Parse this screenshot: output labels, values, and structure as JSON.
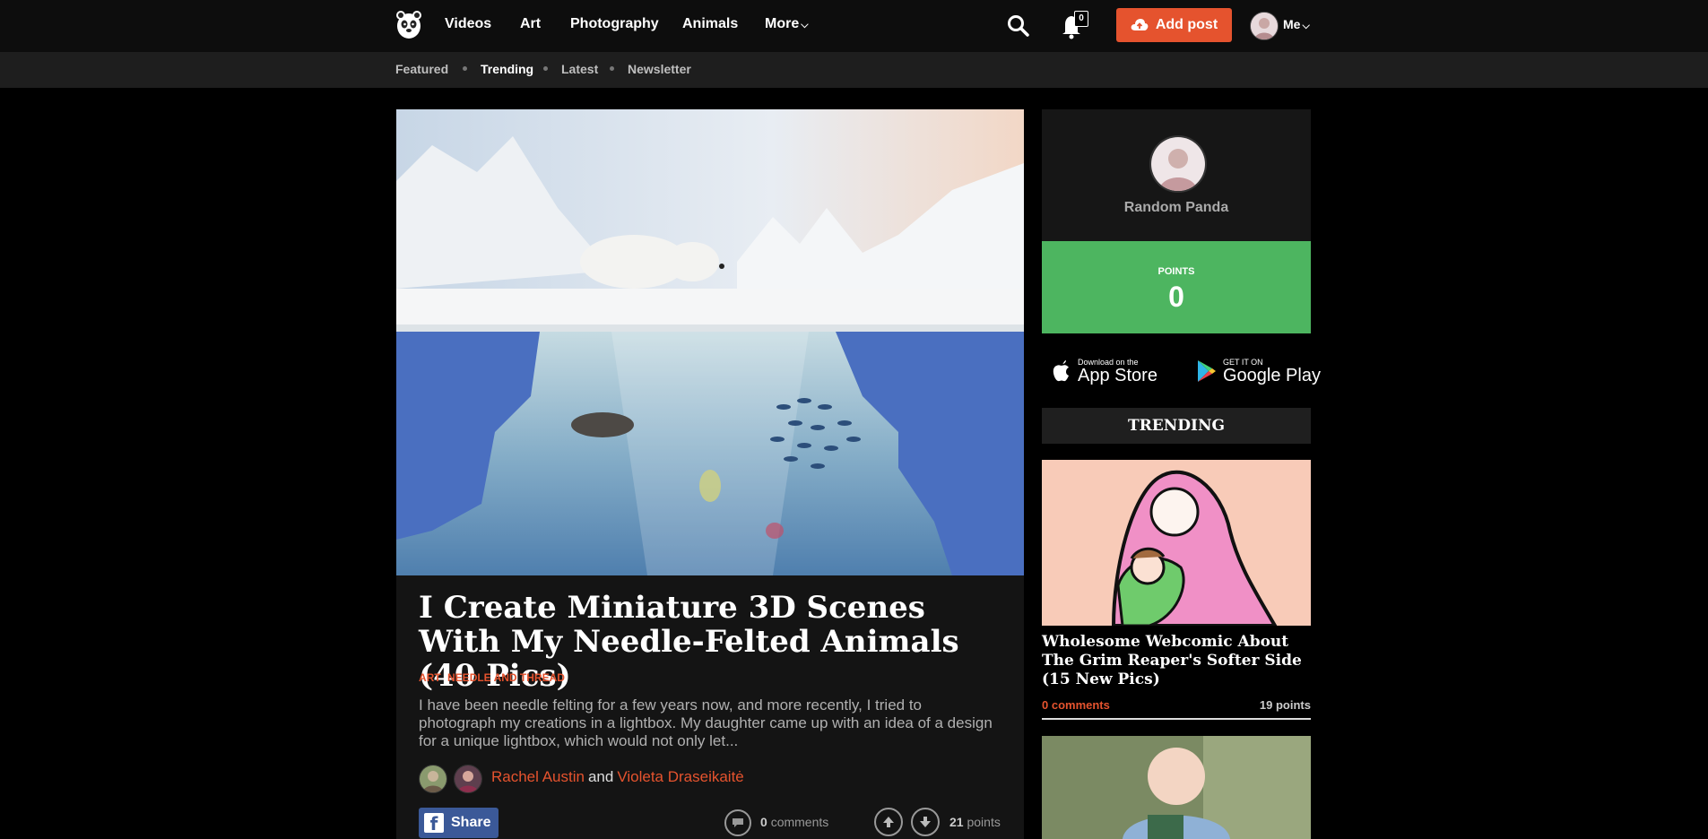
{
  "nav": {
    "items": [
      "Videos",
      "Art",
      "Photography",
      "Animals",
      "More"
    ],
    "notifications_count": "0",
    "add_post_label": "Add post",
    "me_label": "Me"
  },
  "subnav": {
    "items": [
      "Featured",
      "Trending",
      "Latest",
      "Newsletter"
    ],
    "active": "Trending"
  },
  "post": {
    "title": "I Create Miniature 3D Scenes With My Needle-Felted Animals (40 Pics)",
    "categories": [
      "ART",
      "NEEDLE AND THREAD"
    ],
    "excerpt": "I have been needle felting for a few years now, and more recently, I tried to photograph my creations in a lightbox. My daughter came up with an idea of a design for a unique lightbox, which would not only let...",
    "authors": [
      "Rachel Austin",
      "Violeta Draseikaitė"
    ],
    "authors_joiner": "and",
    "share_label": "Share",
    "comments_count": "0",
    "comments_label": "comments",
    "points_count": "21",
    "points_label": "points"
  },
  "sidebar": {
    "profile_name": "Random Panda",
    "points_label": "POINTS",
    "points_value": "0",
    "app_store": {
      "small": "Download on the",
      "big": "App Store"
    },
    "google_play": {
      "small": "GET IT ON",
      "big": "Google Play"
    },
    "trending_heading": "TRENDING",
    "trending_items": [
      {
        "title": "Wholesome Webcomic About The Grim Reaper's Softer Side (15 New Pics)",
        "comments": "0 comments",
        "points": "19 points"
      }
    ]
  },
  "colors": {
    "accent": "#e5532e",
    "points_green": "#4db560",
    "facebook": "#3b5998"
  }
}
